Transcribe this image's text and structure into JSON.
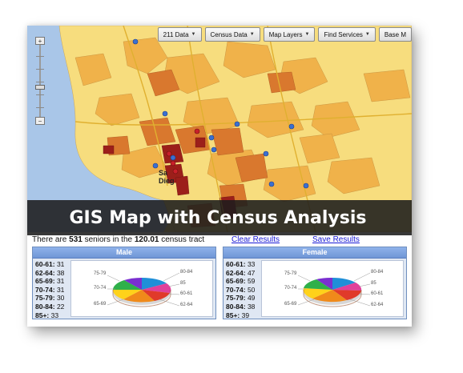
{
  "toolbar": [
    {
      "label": "211 Data"
    },
    {
      "label": "Census Data"
    },
    {
      "label": "Map Layers"
    },
    {
      "label": "Find Services"
    },
    {
      "label": "Base M"
    }
  ],
  "map": {
    "city_label_1": "Sa",
    "city_label_2": "Dieg",
    "zoom_in": "+",
    "zoom_out": "−"
  },
  "banner": {
    "caption": "GIS Map with Census Analysis"
  },
  "summary": {
    "prefix": "There are ",
    "count": "531",
    "middle": " seniors in the ",
    "tract": "120.01",
    "suffix": " census tract",
    "clear_label": "Clear Results",
    "save_label": "Save Results"
  },
  "male": {
    "title": "Male",
    "stats": [
      {
        "range": "60-61:",
        "value": "31"
      },
      {
        "range": "62-64:",
        "value": "38"
      },
      {
        "range": "65-69:",
        "value": "31"
      },
      {
        "range": "70-74:",
        "value": "31"
      },
      {
        "range": "75-79:",
        "value": "30"
      },
      {
        "range": "80-84:",
        "value": "22"
      },
      {
        "range": "85+:",
        "value": "33"
      }
    ],
    "pie_labels": {
      "a": "75-79",
      "b": "70-74",
      "c": "65-69",
      "d": "80-84",
      "e": "85",
      "f": "60-61",
      "g": "62-64"
    }
  },
  "female": {
    "title": "Female",
    "stats": [
      {
        "range": "60-61:",
        "value": "33"
      },
      {
        "range": "62-64:",
        "value": "47"
      },
      {
        "range": "65-69:",
        "value": "59"
      },
      {
        "range": "70-74:",
        "value": "50"
      },
      {
        "range": "75-79:",
        "value": "49"
      },
      {
        "range": "80-84:",
        "value": "38"
      },
      {
        "range": "85+:",
        "value": "39"
      }
    ],
    "pie_labels": {
      "a": "75-79",
      "b": "70-74",
      "c": "65-69",
      "d": "80-84",
      "e": "85",
      "f": "60-61",
      "g": "62-64"
    }
  },
  "colors": {
    "ocean": "#a9c6e8",
    "tract_light": "#f7dd7e",
    "tract_mid": "#f0b24a",
    "tract_dark": "#d9782e",
    "tract_high": "#9c1f1a",
    "point": "#3b6fd0",
    "pie": [
      "#1f8fd8",
      "#e0409a",
      "#e03a2a",
      "#f08a1a",
      "#ffd21a",
      "#2fb04a",
      "#7a2fd0"
    ]
  }
}
